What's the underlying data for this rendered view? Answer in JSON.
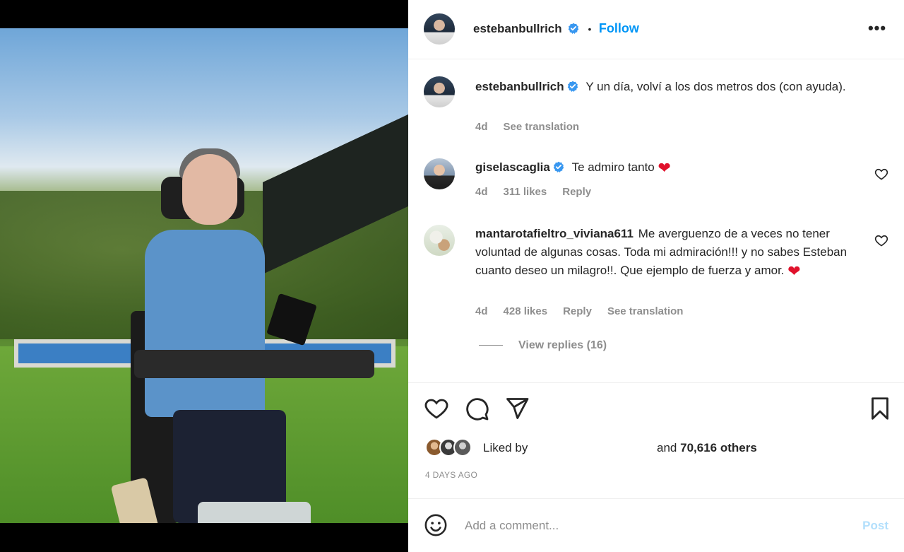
{
  "header": {
    "username": "estebanbullrich",
    "separator": "•",
    "follow_label": "Follow",
    "more_label": "•••"
  },
  "caption": {
    "username": "estebanbullrich",
    "text": "Y un día, volví a los dos metros dos (con ayuda).",
    "age": "4d",
    "see_translation": "See translation"
  },
  "comments": [
    {
      "username": "giselascaglia",
      "text": "Te admiro tanto",
      "emoji": "❤",
      "age": "4d",
      "likes": "311 likes",
      "reply": "Reply"
    },
    {
      "username": "mantarotafieltro_viviana611",
      "text": "Me averguenzo de a veces no tener voluntad de algunas cosas. Toda mi admiración!!! y no sabes Esteban cuanto deseo un milagro!!. Que ejemplo de fuerza y amor.",
      "emoji": "❤",
      "age": "4d",
      "likes": "428 likes",
      "reply": "Reply",
      "see_translation": "See translation",
      "view_replies": "View replies (16)"
    }
  ],
  "engagement": {
    "liked_by": "Liked by",
    "and_others_prefix": "and",
    "others_count": "70,616 others",
    "timestamp": "4 DAYS AGO"
  },
  "composer": {
    "placeholder": "Add a comment...",
    "post_label": "Post"
  },
  "colors": {
    "accent": "#0095f6",
    "verified": "#3897f0",
    "heart": "#e0112b",
    "muted": "#8e8e8e",
    "post_disabled": "#b2dffc"
  },
  "icons": [
    "verified-badge-icon",
    "more-options-icon",
    "heart-outline-icon",
    "comment-bubble-icon",
    "share-paper-plane-icon",
    "bookmark-icon",
    "emoji-smile-icon"
  ]
}
